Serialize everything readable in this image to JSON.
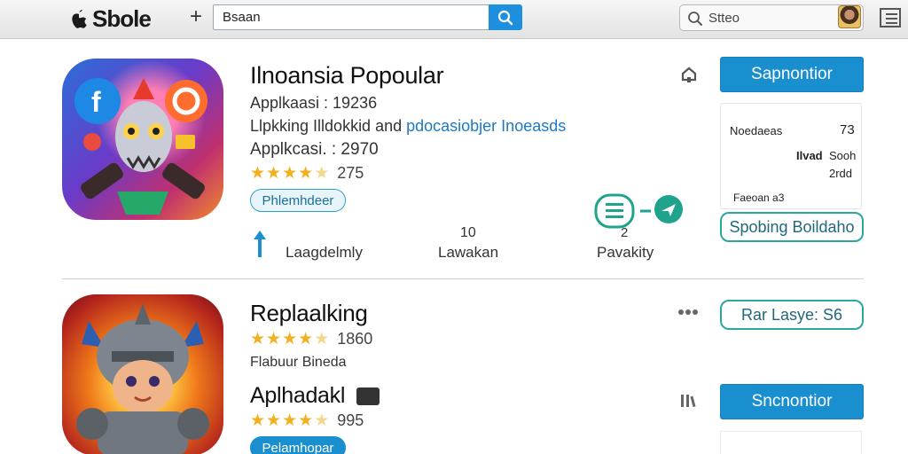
{
  "header": {
    "brand": "Sbole",
    "search_value": "Bsaan",
    "store_search_text": "Stteo"
  },
  "apps": [
    {
      "title": "Ilnoansia Popoular",
      "line1": "Applkaasi : 19236",
      "line2_a": "Llpkking Illdokkid and ",
      "line2_b": "pdocasiobjer Inoeasds",
      "line3": "Applkcasi. : 2970",
      "rating_value": "275",
      "stars": 4.5,
      "tag": "Phlemhdeer",
      "action_button": "Sapnontior",
      "info_card": {
        "label": "Noedaeas",
        "value": "73",
        "mid_a": "Ilvad",
        "mid_b": "Sooh",
        "mid_c": "2rdd",
        "footer": "Faeoan a3"
      },
      "secondary_button": "Spobing Boildaho",
      "stats": [
        {
          "label": "Laagdelmly"
        },
        {
          "value": "10",
          "label": "Lawakan"
        },
        {
          "value": "2",
          "label": "Pavakity"
        }
      ]
    },
    {
      "title": "Replaalking",
      "rating_value_a": "1860",
      "stars_a": 4.5,
      "subtitle": "Flabuur Bineda",
      "title_b": "Aplhadakl",
      "rating_value_b": "995",
      "stars_b": 4.5,
      "tag": "Pelamhopar",
      "outline_button": "Rar Lasye: S6",
      "action_button": "Sncnontior"
    }
  ],
  "colors": {
    "accent": "#1a8fd0",
    "star": "#f2b01e",
    "teal": "#2aa7a0"
  }
}
